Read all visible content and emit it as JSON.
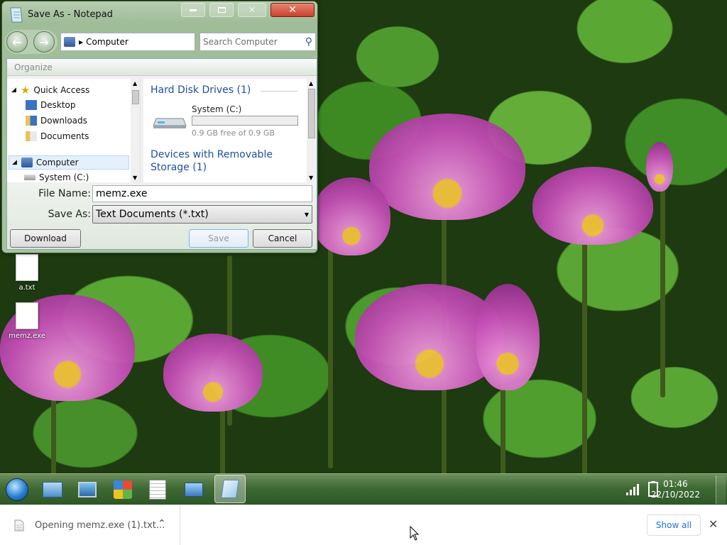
{
  "dialog": {
    "title": "Save As - Notepad",
    "address_path": "Computer",
    "search_placeholder": "Search Computer",
    "organize_label": "Organize",
    "nav": {
      "quick_access": "Quick Access",
      "desktop": "Desktop",
      "downloads": "Downloads",
      "documents": "Documents",
      "computer": "Computer",
      "system_c": "System (C:)"
    },
    "content": {
      "hdd_group": "Hard Disk Drives (1)",
      "drive_name": "System (C:)",
      "drive_free": "0.9 GB free of 0.9 GB",
      "drive_used_fraction": 0.0,
      "removable_group": "Devices with Removable Storage (1)"
    },
    "filename_label": "File Name:",
    "filename_value": "memz.exe",
    "saveas_label": "Save As:",
    "saveas_value": "Text Documents (*.txt)",
    "download_button": "Download",
    "save_button": "Save",
    "cancel_button": "Cancel"
  },
  "desktop_icons": [
    {
      "label": "a.txt",
      "icon": "text-file-icon"
    },
    {
      "label": "memz.exe",
      "icon": "text-file-icon"
    }
  ],
  "taskbar": {
    "time": "01:46",
    "date": "22/10/2022",
    "icons": [
      "start-orb-icon",
      "control-panel-icon",
      "computer-icon",
      "media-center-icon",
      "file-manager-icon",
      "network-icon",
      "notepad-icon"
    ]
  },
  "download_bar": {
    "item_text": "Opening memz.exe (1).txt...",
    "show_all": "Show all"
  },
  "colors": {
    "close_button": "#c9432f",
    "taskbar": "#3f6a34",
    "dialog_frame": "#a6c2a0",
    "link_blue": "#1e4e9e"
  }
}
